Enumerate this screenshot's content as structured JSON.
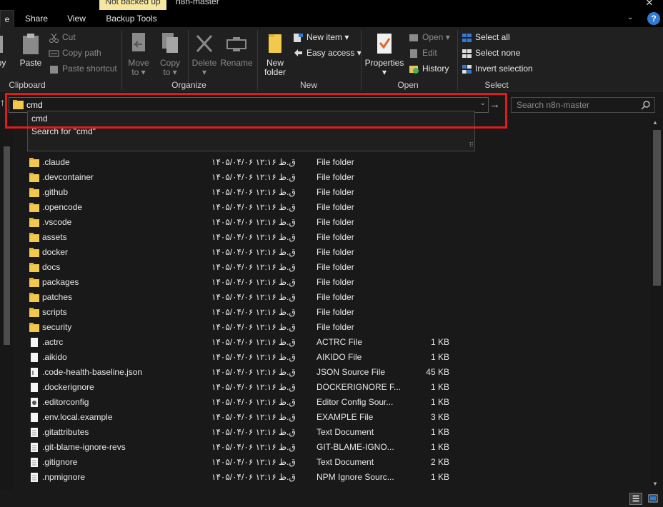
{
  "window": {
    "title": "n8n-master",
    "context_tab": "Not backed up",
    "close_glyph": "✕"
  },
  "tabs": {
    "home": "e",
    "share": "Share",
    "view": "View",
    "backup_tools": "Backup Tools"
  },
  "ribbon": {
    "clipboard": {
      "label": "Clipboard",
      "copy_partial": "py",
      "paste": "Paste",
      "cut": "Cut",
      "copy_path": "Copy path",
      "paste_shortcut": "Paste shortcut"
    },
    "organize": {
      "label": "Organize",
      "move_to_1": "Move",
      "move_to_2": "to",
      "copy_to_1": "Copy",
      "copy_to_2": "to",
      "delete": "Delete",
      "rename": "Rename"
    },
    "new": {
      "label": "New",
      "new_folder_1": "New",
      "new_folder_2": "folder",
      "new_item": "New item",
      "easy_access": "Easy access"
    },
    "open": {
      "label": "Open",
      "properties": "Properties",
      "open": "Open",
      "edit": "Edit",
      "history": "History"
    },
    "select": {
      "label": "Select",
      "select_all": "Select all",
      "select_none": "Select none",
      "invert_selection": "Invert selection"
    }
  },
  "address": {
    "value": "cmd",
    "suggestions": [
      "cmd",
      "Search for \"cmd\""
    ]
  },
  "search": {
    "placeholder": "Search n8n-master"
  },
  "files": [
    {
      "name": ".claude",
      "date": "۱۴۰۵/۰۴/۰۶ ق.ظ ۱۲:۱۶",
      "type": "File folder",
      "size": "",
      "kind": "folder"
    },
    {
      "name": ".devcontainer",
      "date": "۱۴۰۵/۰۴/۰۶ ق.ظ ۱۲:۱۶",
      "type": "File folder",
      "size": "",
      "kind": "folder"
    },
    {
      "name": ".github",
      "date": "۱۴۰۵/۰۴/۰۶ ق.ظ ۱۲:۱۶",
      "type": "File folder",
      "size": "",
      "kind": "folder"
    },
    {
      "name": ".opencode",
      "date": "۱۴۰۵/۰۴/۰۶ ق.ظ ۱۲:۱۶",
      "type": "File folder",
      "size": "",
      "kind": "folder"
    },
    {
      "name": ".vscode",
      "date": "۱۴۰۵/۰۴/۰۶ ق.ظ ۱۲:۱۶",
      "type": "File folder",
      "size": "",
      "kind": "folder"
    },
    {
      "name": "assets",
      "date": "۱۴۰۵/۰۴/۰۶ ق.ظ ۱۲:۱۶",
      "type": "File folder",
      "size": "",
      "kind": "folder"
    },
    {
      "name": "docker",
      "date": "۱۴۰۵/۰۴/۰۶ ق.ظ ۱۲:۱۶",
      "type": "File folder",
      "size": "",
      "kind": "folder"
    },
    {
      "name": "docs",
      "date": "۱۴۰۵/۰۴/۰۶ ق.ظ ۱۲:۱۶",
      "type": "File folder",
      "size": "",
      "kind": "folder"
    },
    {
      "name": "packages",
      "date": "۱۴۰۵/۰۴/۰۶ ق.ظ ۱۲:۱۶",
      "type": "File folder",
      "size": "",
      "kind": "folder"
    },
    {
      "name": "patches",
      "date": "۱۴۰۵/۰۴/۰۶ ق.ظ ۱۲:۱۶",
      "type": "File folder",
      "size": "",
      "kind": "folder"
    },
    {
      "name": "scripts",
      "date": "۱۴۰۵/۰۴/۰۶ ق.ظ ۱۲:۱۶",
      "type": "File folder",
      "size": "",
      "kind": "folder"
    },
    {
      "name": "security",
      "date": "۱۴۰۵/۰۴/۰۶ ق.ظ ۱۲:۱۶",
      "type": "File folder",
      "size": "",
      "kind": "folder"
    },
    {
      "name": ".actrc",
      "date": "۱۴۰۵/۰۴/۰۶ ق.ظ ۱۲:۱۶",
      "type": "ACTRC File",
      "size": "1 KB",
      "kind": "file"
    },
    {
      "name": ".aikido",
      "date": "۱۴۰۵/۰۴/۰۶ ق.ظ ۱۲:۱۶",
      "type": "AIKIDO File",
      "size": "1 KB",
      "kind": "file"
    },
    {
      "name": ".code-health-baseline.json",
      "date": "۱۴۰۵/۰۴/۰۶ ق.ظ ۱۲:۱۶",
      "type": "JSON Source File",
      "size": "45 KB",
      "kind": "json"
    },
    {
      "name": ".dockerignore",
      "date": "۱۴۰۵/۰۴/۰۶ ق.ظ ۱۲:۱۶",
      "type": "DOCKERIGNORE F...",
      "size": "1 KB",
      "kind": "file"
    },
    {
      "name": ".editorconfig",
      "date": "۱۴۰۵/۰۴/۰۶ ق.ظ ۱۲:۱۶",
      "type": "Editor Config Sour...",
      "size": "1 KB",
      "kind": "gear"
    },
    {
      "name": ".env.local.example",
      "date": "۱۴۰۵/۰۴/۰۶ ق.ظ ۱۲:۱۶",
      "type": "EXAMPLE File",
      "size": "3 KB",
      "kind": "file"
    },
    {
      "name": ".gitattributes",
      "date": "۱۴۰۵/۰۴/۰۶ ق.ظ ۱۲:۱۶",
      "type": "Text Document",
      "size": "1 KB",
      "kind": "text"
    },
    {
      "name": ".git-blame-ignore-revs",
      "date": "۱۴۰۵/۰۴/۰۶ ق.ظ ۱۲:۱۶",
      "type": "GIT-BLAME-IGNO...",
      "size": "1 KB",
      "kind": "text"
    },
    {
      "name": ".gitignore",
      "date": "۱۴۰۵/۰۴/۰۶ ق.ظ ۱۲:۱۶",
      "type": "Text Document",
      "size": "2 KB",
      "kind": "text"
    },
    {
      "name": ".npmignore",
      "date": "۱۴۰۵/۰۴/۰۶ ق.ظ ۱۲:۱۶",
      "type": "NPM Ignore Sourc...",
      "size": "1 KB",
      "kind": "text"
    }
  ],
  "colors": {
    "highlight_box": "#e01b1b",
    "folder": "#f2c94c",
    "accent": "#2f7bd6"
  }
}
